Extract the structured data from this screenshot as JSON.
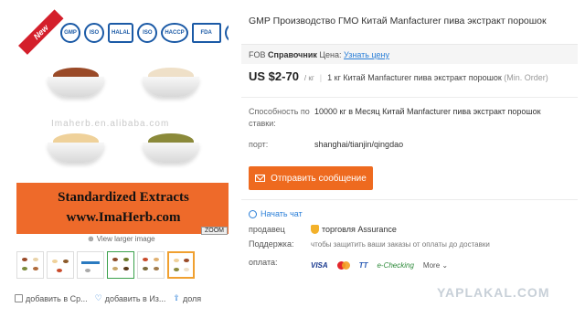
{
  "gallery": {
    "badge": "New",
    "certifications": [
      "GMP",
      "ISO",
      "HALAL",
      "ISO",
      "HACCP",
      "FDA",
      "QS"
    ],
    "image_watermark": "Imaherb.en.alibaba.com",
    "banner_line1": "Standardized Extracts",
    "banner_line2": "www.ImaHerb.com",
    "zoom_label": "ZOOM",
    "view_larger": "View larger image",
    "actions": {
      "compare": "добавить в Ср...",
      "favorite": "добавить в Из...",
      "share": "доля"
    }
  },
  "product": {
    "title": "GMP Производство ГМО Китай Manfacturer пива экстракт порошок",
    "fob_prefix": "FOB",
    "fob_ref": "Справочник",
    "fob_price_label": "Цена:",
    "fob_link": "Узнать цену",
    "price": "US $2-70",
    "price_unit": "/ кг",
    "moq": "1 кг Китай Manfacturer пива экстракт порошок",
    "moq_note": "(Min. Order)",
    "supply_label": "Способность по ставки:",
    "supply_value": "10000 кг в Месяц Китай Manfacturer пива экстракт порошок",
    "port_label": "порт:",
    "port_value": "shanghai/tianjin/qingdao",
    "contact_button": "Отправить сообщение",
    "chat_link": "Начать чат",
    "seller_label": "продавец",
    "seller_value": "торговля Assurance",
    "support_label": "Поддержка:",
    "support_value": "чтобы защитить ваши заказы от оплаты до доставки",
    "payment_label": "оплата:",
    "payment_methods": {
      "visa": "VISA",
      "tt": "TT",
      "echeck": "e-Checking",
      "more": "More"
    }
  },
  "site_watermark": "YAPLAKAL.COM"
}
